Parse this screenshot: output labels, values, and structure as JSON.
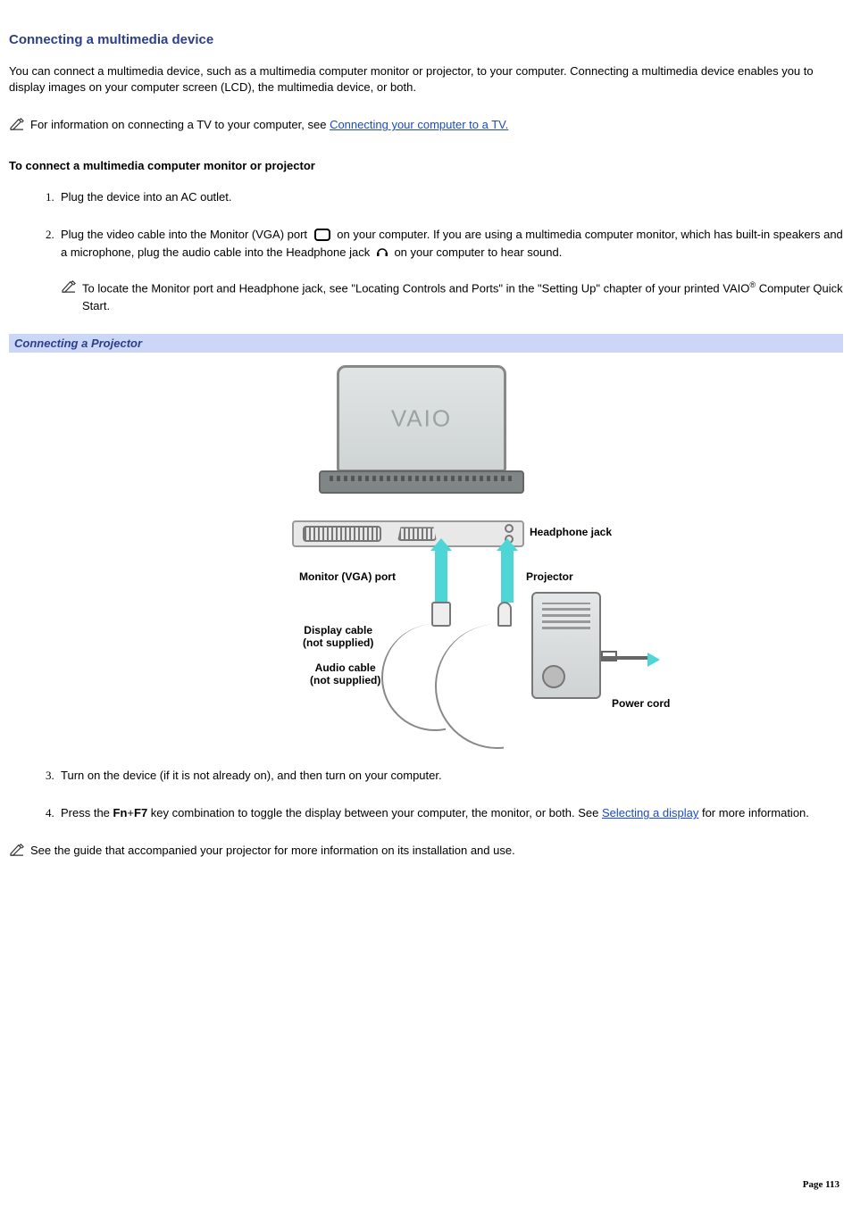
{
  "title": "Connecting a multimedia device",
  "intro": "You can connect a multimedia device, such as a multimedia computer monitor or projector, to your computer. Connecting a multimedia device enables you to display images on your computer screen (LCD), the multimedia device, or both.",
  "note1_prefix": "For information on connecting a TV to your computer, see ",
  "note1_link": "Connecting your computer to a TV.",
  "sub_heading": "To connect a multimedia computer monitor or projector",
  "step1": "Plug the device into an AC outlet.",
  "step2_a": "Plug the video cable into the Monitor (VGA) port ",
  "step2_b": " on your computer. If you are using a multimedia computer monitor, which has built-in speakers and a microphone, plug the audio cable into the Headphone jack ",
  "step2_c": " on your computer to hear sound.",
  "step2_note_a": "To locate the Monitor port and Headphone jack, see \"Locating Controls and Ports\" in the \"Setting Up\" chapter of your printed VAIO",
  "step2_note_b": " Computer Quick Start.",
  "reg_mark": "®",
  "figure_title": "Connecting a Projector",
  "fig_labels": {
    "headphone": "Headphone jack",
    "projector": "Projector",
    "vga_port": "Monitor (VGA) port",
    "display_cable_l1": "Display cable",
    "not_supplied": "(not supplied)",
    "audio_cable_l1": "Audio cable",
    "power_cord": "Power cord",
    "vaio_logo": "VAIO"
  },
  "step3": "Turn on the device (if it is not already on), and then turn on your computer.",
  "step4_a": "Press the ",
  "step4_key1": "Fn",
  "step4_plus": "+",
  "step4_key2": "F7",
  "step4_b": " key combination to toggle the display between your computer, the monitor, or both. See ",
  "step4_link": "Selecting a display",
  "step4_c": " for more information.",
  "final_note": "See the guide that accompanied your projector for more information on its installation and use.",
  "footer": "Page 113"
}
